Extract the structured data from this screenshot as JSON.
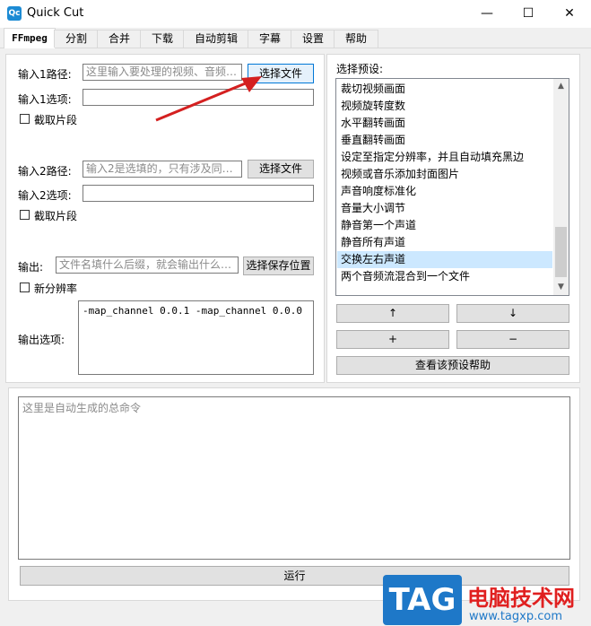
{
  "window": {
    "title": "Quick Cut",
    "app_icon_text": "Qc",
    "minimize": "—",
    "maximize": "☐",
    "close": "✕"
  },
  "tabs": [
    "FFmpeg",
    "分割",
    "合并",
    "下载",
    "自动剪辑",
    "字幕",
    "设置",
    "帮助"
  ],
  "left": {
    "input1_label": "输入1路径:",
    "input1_placeholder": "这里输入要处理的视频、音频…",
    "input1_button": "选择文件",
    "input1_opts_label": "输入1选项:",
    "input1_opts_value": "",
    "clip1_label": "截取片段",
    "input2_label": "输入2路径:",
    "input2_placeholder": "输入2是选填的，只有涉及同…",
    "input2_button": "选择文件",
    "input2_opts_label": "输入2选项:",
    "input2_opts_value": "",
    "clip2_label": "截取片段",
    "output_label": "输出:",
    "output_placeholder": "文件名填什么后缀，就会输出什么…",
    "output_button": "选择保存位置",
    "resolution_label": "新分辨率",
    "output_opts_label": "输出选项:",
    "output_opts_value": "-map_channel 0.0.1 -map_channel 0.0.0"
  },
  "right": {
    "preset_title": "选择预设:",
    "presets": [
      "裁切视频画面",
      "视频旋转度数",
      "水平翻转画面",
      "垂直翻转画面",
      "设定至指定分辨率，并且自动填充黑边",
      "视频或音乐添加封面图片",
      "声音响度标准化",
      "音量大小调节",
      "静音第一个声道",
      "静音所有声道",
      "交换左右声道",
      "两个音频流混合到一个文件"
    ],
    "selected_index": 10,
    "btn_up": "↑",
    "btn_down": "↓",
    "btn_add": "+",
    "btn_remove": "−",
    "btn_help": "查看该预设帮助"
  },
  "command": {
    "placeholder": "这里是自动生成的总命令"
  },
  "run_button": "运行",
  "watermark": {
    "logo": "TAG",
    "site_name": "电脑技术网",
    "url": "www.tagxp.com"
  }
}
